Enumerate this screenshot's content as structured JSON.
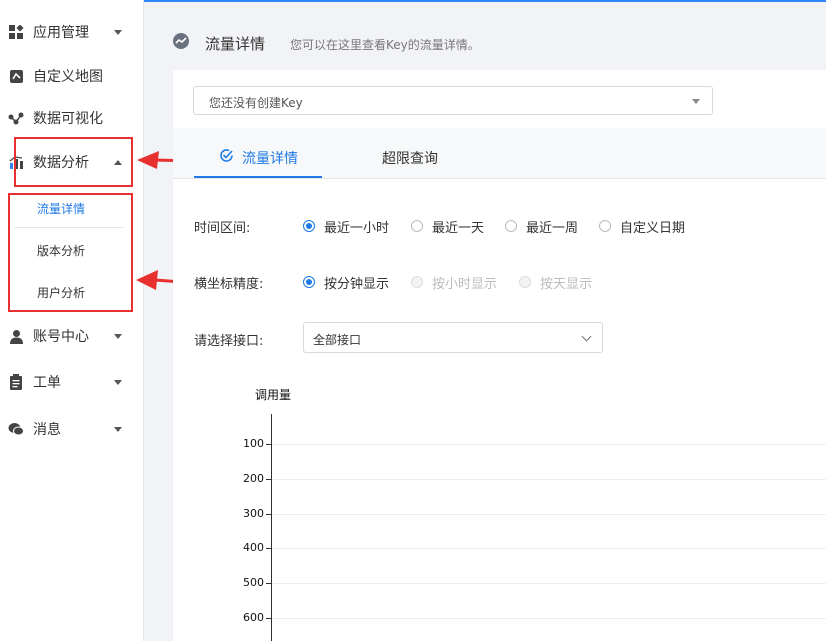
{
  "sidebar": {
    "items": [
      {
        "label": "应用管理",
        "icon": "grid-apps-icon",
        "caret": "down"
      },
      {
        "label": "自定义地图",
        "icon": "map-icon"
      },
      {
        "label": "数据可视化",
        "icon": "network-icon"
      },
      {
        "label": "数据分析",
        "icon": "bar-chart-icon",
        "caret": "up"
      },
      {
        "label": "账号中心",
        "icon": "user-icon",
        "caret": "down"
      },
      {
        "label": "工单",
        "icon": "clipboard-icon",
        "caret": "down"
      },
      {
        "label": "消息",
        "icon": "chat-icon",
        "caret": "down"
      }
    ],
    "subitems": [
      {
        "label": "流量详情",
        "active": true
      },
      {
        "label": "版本分析"
      },
      {
        "label": "用户分析"
      }
    ]
  },
  "header": {
    "title": "流量详情",
    "subtitle": "您可以在这里查看Key的流量详情。"
  },
  "key_select": {
    "value": "您还没有创建Key"
  },
  "tabs": [
    {
      "label": "流量详情",
      "active": true
    },
    {
      "label": "超限查询"
    }
  ],
  "time_range": {
    "label": "时间区间:",
    "options": [
      "最近一小时",
      "最近一天",
      "最近一周",
      "自定义日期"
    ],
    "selected": "最近一小时"
  },
  "x_precision": {
    "label": "横坐标精度:",
    "options": [
      "按分钟显示",
      "按小时显示",
      "按天显示"
    ],
    "selected": "按分钟显示",
    "disabled": [
      "按小时显示",
      "按天显示"
    ]
  },
  "api_select": {
    "label": "请选择接口:",
    "value": "全部接口"
  },
  "chart_data": {
    "type": "line",
    "title": "",
    "ylabel": "调用量",
    "xlabel": "",
    "y_ticks": [
      "100",
      "200",
      "300",
      "400",
      "500",
      "600"
    ],
    "series": []
  },
  "colors": {
    "accent": "#1f7ae6",
    "annotation": "#e8302f"
  }
}
